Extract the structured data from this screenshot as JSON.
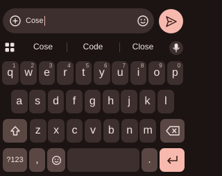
{
  "compose": {
    "text": "Cose",
    "add_icon": "add-circle-icon",
    "emoji_icon": "emoji-icon",
    "send_icon": "send-icon"
  },
  "suggestions": {
    "grid_icon": "apps-grid-icon",
    "items": [
      "Cose",
      "Code",
      "Close"
    ],
    "mic_icon": "microphone-icon"
  },
  "keyboard": {
    "row1": [
      {
        "letter": "q",
        "num": "1"
      },
      {
        "letter": "w",
        "num": "2"
      },
      {
        "letter": "e",
        "num": "3"
      },
      {
        "letter": "r",
        "num": "4"
      },
      {
        "letter": "t",
        "num": "5"
      },
      {
        "letter": "y",
        "num": "6"
      },
      {
        "letter": "u",
        "num": "7"
      },
      {
        "letter": "i",
        "num": "8"
      },
      {
        "letter": "o",
        "num": "9"
      },
      {
        "letter": "p",
        "num": "0"
      }
    ],
    "row2": [
      "a",
      "s",
      "d",
      "f",
      "g",
      "h",
      "j",
      "k",
      "l"
    ],
    "row3": [
      "z",
      "x",
      "c",
      "v",
      "b",
      "n",
      "m"
    ],
    "symbols_label": "?123",
    "comma_label": ",",
    "period_label": ".",
    "shift_icon": "shift-icon",
    "backspace_icon": "backspace-icon",
    "emoji_icon": "emoji-icon",
    "enter_icon": "enter-icon"
  },
  "colors": {
    "background": "#1b1413",
    "key": "#3c2f2d",
    "special_key": "#5a4744",
    "accent": "#f7b9ae"
  }
}
